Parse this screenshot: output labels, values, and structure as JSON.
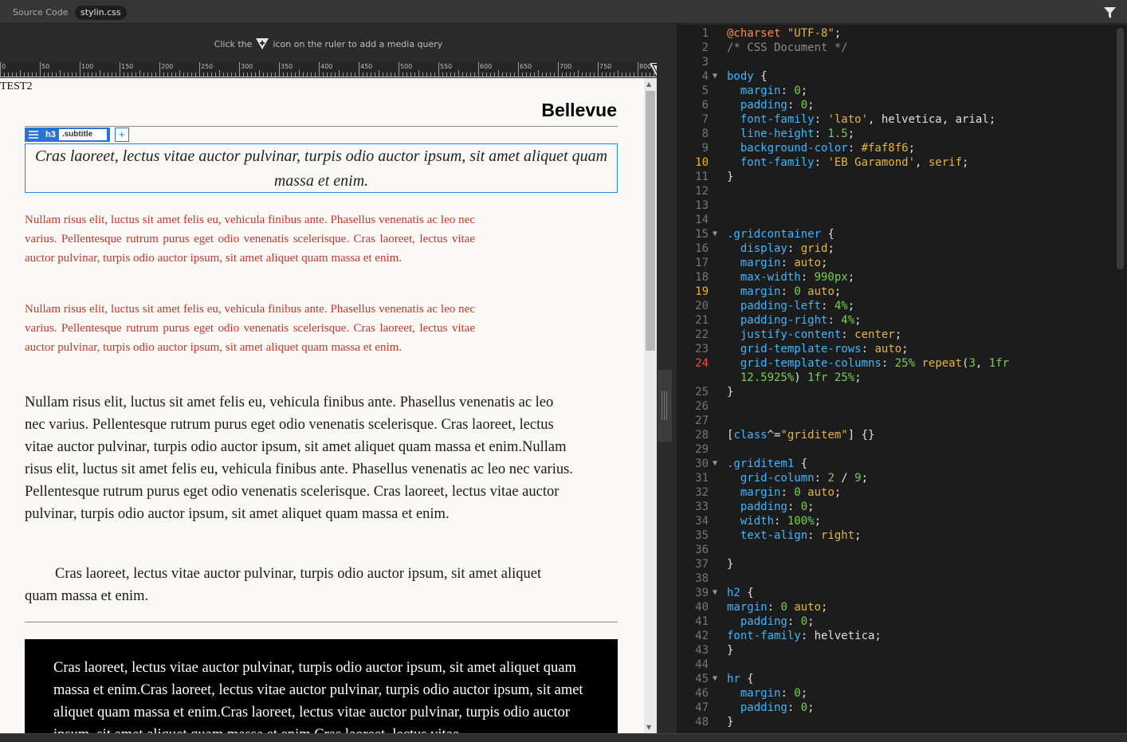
{
  "tabs": {
    "source_label": "Source Code",
    "file_label": "stylin.css"
  },
  "media_hint": {
    "before": "Click the",
    "after": "icon on the ruler to add a media query"
  },
  "ruler": {
    "labels": [
      "0",
      "50",
      "100",
      "150",
      "200",
      "250",
      "300",
      "350",
      "400",
      "450",
      "500",
      "550",
      "600",
      "650",
      "700",
      "750",
      "800"
    ]
  },
  "page": {
    "test_label": "TEST2",
    "heading": "Bellevue",
    "selector": {
      "tag": "h3",
      "class": ".subtitle",
      "add": "+"
    },
    "subtitle": "Cras laoreet, lectus vitae auctor pulvinar, turpis odio auctor ipsum, sit amet aliquet quam massa et enim.",
    "red_paragraphs": [
      "Nullam risus elit, luctus sit amet felis eu, vehicula finibus ante. Phasellus venenatis ac leo nec varius. Pellentesque rutrum purus eget odio venenatis scelerisque. Cras laoreet, lectus vitae auctor pulvinar, turpis odio auctor ipsum, sit amet aliquet quam massa et enim.",
      "Nullam risus elit, luctus sit amet felis eu, vehicula finibus ante. Phasellus venenatis ac leo nec varius. Pellentesque rutrum purus eget odio venenatis scelerisque. Cras laoreet, lectus vitae auctor pulvinar, turpis odio auctor ipsum, sit amet aliquet quam massa et enim."
    ],
    "body_paragraph": "Nullam risus elit, luctus sit amet felis eu, vehicula finibus ante. Phasellus venenatis ac leo nec varius. Pellentesque rutrum purus eget odio venenatis scelerisque. Cras laoreet, lectus vitae auctor pulvinar, turpis odio auctor ipsum, sit amet aliquet quam massa et enim.Nullam risus elit, luctus sit amet felis eu, vehicula finibus ante. Phasellus venenatis ac leo nec varius. Pellentesque rutrum purus eget odio venenatis scelerisque. Cras laoreet, lectus vitae auctor pulvinar, turpis odio auctor ipsum, sit amet aliquet quam massa et enim.",
    "indented_paragraph": "Cras laoreet, lectus vitae auctor pulvinar, turpis odio auctor ipsum, sit amet aliquet quam massa et enim.",
    "black_box": "Cras laoreet, lectus vitae auctor pulvinar, turpis odio auctor ipsum, sit amet aliquet quam massa et enim.Cras laoreet, lectus vitae auctor pulvinar, turpis odio auctor ipsum, sit amet aliquet quam massa et enim.Cras laoreet, lectus vitae auctor pulvinar, turpis odio auctor ipsum, sit amet aliquet quam massa et enim.Cras laoreet, lectus vitae"
  },
  "code": {
    "highlight_lines": [
      10,
      19
    ],
    "error_lines": [
      24
    ],
    "fold_lines": [
      4,
      15,
      30,
      39,
      45
    ],
    "lines": [
      {
        "n": "1",
        "t": [
          [
            "at",
            "@charset"
          ],
          [
            "w",
            " "
          ],
          [
            "s",
            "\"UTF-8\""
          ],
          [
            "w",
            ";"
          ]
        ]
      },
      {
        "n": "2",
        "t": [
          [
            "c",
            "/* CSS Document */"
          ]
        ]
      },
      {
        "n": "3",
        "t": []
      },
      {
        "n": "4",
        "t": [
          [
            "k",
            "body"
          ],
          [
            "w",
            " {"
          ]
        ]
      },
      {
        "n": "5",
        "t": [
          [
            "w",
            "  "
          ],
          [
            "p",
            "margin"
          ],
          [
            "w",
            ": "
          ],
          [
            "n",
            "0"
          ],
          [
            "w",
            ";"
          ]
        ]
      },
      {
        "n": "6",
        "t": [
          [
            "w",
            "  "
          ],
          [
            "p",
            "padding"
          ],
          [
            "w",
            ": "
          ],
          [
            "n",
            "0"
          ],
          [
            "w",
            ";"
          ]
        ]
      },
      {
        "n": "7",
        "t": [
          [
            "w",
            "  "
          ],
          [
            "p",
            "font-family"
          ],
          [
            "w",
            ": "
          ],
          [
            "s",
            "'lato'"
          ],
          [
            "w",
            ", helvetica, arial;"
          ]
        ]
      },
      {
        "n": "8",
        "t": [
          [
            "w",
            "  "
          ],
          [
            "p",
            "line-height"
          ],
          [
            "w",
            ": "
          ],
          [
            "n",
            "1.5"
          ],
          [
            "w",
            ";"
          ]
        ]
      },
      {
        "n": "9",
        "t": [
          [
            "w",
            "  "
          ],
          [
            "p",
            "background-color"
          ],
          [
            "w",
            ": "
          ],
          [
            "v",
            "#faf8f6"
          ],
          [
            "w",
            ";"
          ]
        ]
      },
      {
        "n": "10",
        "t": [
          [
            "w",
            "  "
          ],
          [
            "p",
            "font-family"
          ],
          [
            "w",
            ": "
          ],
          [
            "s",
            "'EB Garamond'"
          ],
          [
            "w",
            ", "
          ],
          [
            "v",
            "serif"
          ],
          [
            "w",
            ";"
          ]
        ]
      },
      {
        "n": "11",
        "t": [
          [
            "w",
            "}"
          ]
        ]
      },
      {
        "n": "12",
        "t": []
      },
      {
        "n": "13",
        "t": []
      },
      {
        "n": "14",
        "t": []
      },
      {
        "n": "15",
        "t": [
          [
            "k",
            ".gridcontainer"
          ],
          [
            "w",
            " {"
          ]
        ]
      },
      {
        "n": "16",
        "t": [
          [
            "w",
            "  "
          ],
          [
            "p",
            "display"
          ],
          [
            "w",
            ": "
          ],
          [
            "v",
            "grid"
          ],
          [
            "w",
            ";"
          ]
        ]
      },
      {
        "n": "17",
        "t": [
          [
            "w",
            "  "
          ],
          [
            "p",
            "margin"
          ],
          [
            "w",
            ": "
          ],
          [
            "v",
            "auto"
          ],
          [
            "w",
            ";"
          ]
        ]
      },
      {
        "n": "18",
        "t": [
          [
            "w",
            "  "
          ],
          [
            "p",
            "max-width"
          ],
          [
            "w",
            ": "
          ],
          [
            "n",
            "990px"
          ],
          [
            "w",
            ";"
          ]
        ]
      },
      {
        "n": "19",
        "t": [
          [
            "w",
            "  "
          ],
          [
            "p",
            "margin"
          ],
          [
            "w",
            ": "
          ],
          [
            "n",
            "0"
          ],
          [
            "w",
            " "
          ],
          [
            "v",
            "auto"
          ],
          [
            "w",
            ";"
          ]
        ]
      },
      {
        "n": "20",
        "t": [
          [
            "w",
            "  "
          ],
          [
            "p",
            "padding-left"
          ],
          [
            "w",
            ": "
          ],
          [
            "n",
            "4%"
          ],
          [
            "w",
            ";"
          ]
        ]
      },
      {
        "n": "21",
        "t": [
          [
            "w",
            "  "
          ],
          [
            "p",
            "padding-right"
          ],
          [
            "w",
            ": "
          ],
          [
            "n",
            "4%"
          ],
          [
            "w",
            ";"
          ]
        ]
      },
      {
        "n": "22",
        "t": [
          [
            "w",
            "  "
          ],
          [
            "p",
            "justify-content"
          ],
          [
            "w",
            ": "
          ],
          [
            "v",
            "center"
          ],
          [
            "w",
            ";"
          ]
        ]
      },
      {
        "n": "23",
        "t": [
          [
            "w",
            "  "
          ],
          [
            "p",
            "grid-template-rows"
          ],
          [
            "w",
            ": "
          ],
          [
            "v",
            "auto"
          ],
          [
            "w",
            ";"
          ]
        ]
      },
      {
        "n": "24",
        "t": [
          [
            "w",
            "  "
          ],
          [
            "p",
            "grid-template-columns"
          ],
          [
            "w",
            ": "
          ],
          [
            "n",
            "25%"
          ],
          [
            "w",
            " "
          ],
          [
            "v",
            "repeat"
          ],
          [
            "w",
            "("
          ],
          [
            "n",
            "3"
          ],
          [
            "w",
            ", "
          ],
          [
            "n",
            "1fr"
          ]
        ]
      },
      {
        "n": "",
        "t": [
          [
            "w",
            "  "
          ],
          [
            "n",
            "12.5925%"
          ],
          [
            "w",
            ") "
          ],
          [
            "n",
            "1fr"
          ],
          [
            "w",
            " "
          ],
          [
            "n",
            "25%"
          ],
          [
            "w",
            ";"
          ]
        ]
      },
      {
        "n": "25",
        "t": [
          [
            "w",
            "}"
          ]
        ]
      },
      {
        "n": "26",
        "t": []
      },
      {
        "n": "27",
        "t": []
      },
      {
        "n": "28",
        "t": [
          [
            "w",
            "["
          ],
          [
            "k",
            "class"
          ],
          [
            "w",
            "^="
          ],
          [
            "s",
            "\"griditem\""
          ],
          [
            "w",
            "] {}"
          ]
        ]
      },
      {
        "n": "29",
        "t": []
      },
      {
        "n": "30",
        "t": [
          [
            "k",
            ".griditem1"
          ],
          [
            "w",
            " {"
          ]
        ]
      },
      {
        "n": "31",
        "t": [
          [
            "w",
            "  "
          ],
          [
            "p",
            "grid-column"
          ],
          [
            "w",
            ": "
          ],
          [
            "n",
            "2"
          ],
          [
            "w",
            " / "
          ],
          [
            "n",
            "9"
          ],
          [
            "w",
            ";"
          ]
        ]
      },
      {
        "n": "32",
        "t": [
          [
            "w",
            "  "
          ],
          [
            "p",
            "margin"
          ],
          [
            "w",
            ": "
          ],
          [
            "n",
            "0"
          ],
          [
            "w",
            " "
          ],
          [
            "v",
            "auto"
          ],
          [
            "w",
            ";"
          ]
        ]
      },
      {
        "n": "33",
        "t": [
          [
            "w",
            "  "
          ],
          [
            "p",
            "padding"
          ],
          [
            "w",
            ": "
          ],
          [
            "n",
            "0"
          ],
          [
            "w",
            ";"
          ]
        ]
      },
      {
        "n": "34",
        "t": [
          [
            "w",
            "  "
          ],
          [
            "p",
            "width"
          ],
          [
            "w",
            ": "
          ],
          [
            "n",
            "100%"
          ],
          [
            "w",
            ";"
          ]
        ]
      },
      {
        "n": "35",
        "t": [
          [
            "w",
            "  "
          ],
          [
            "p",
            "text-align"
          ],
          [
            "w",
            ": "
          ],
          [
            "v",
            "right"
          ],
          [
            "w",
            ";"
          ]
        ]
      },
      {
        "n": "36",
        "t": []
      },
      {
        "n": "37",
        "t": [
          [
            "w",
            "}"
          ]
        ]
      },
      {
        "n": "38",
        "t": []
      },
      {
        "n": "39",
        "t": [
          [
            "k",
            "h2"
          ],
          [
            "w",
            " {"
          ]
        ]
      },
      {
        "n": "40",
        "t": [
          [
            "p",
            "margin"
          ],
          [
            "w",
            ": "
          ],
          [
            "n",
            "0"
          ],
          [
            "w",
            " "
          ],
          [
            "v",
            "auto"
          ],
          [
            "w",
            ";"
          ]
        ]
      },
      {
        "n": "41",
        "t": [
          [
            "w",
            "  "
          ],
          [
            "p",
            "padding"
          ],
          [
            "w",
            ": "
          ],
          [
            "n",
            "0"
          ],
          [
            "w",
            ";"
          ]
        ]
      },
      {
        "n": "42",
        "t": [
          [
            "p",
            "font-family"
          ],
          [
            "w",
            ": helvetica;"
          ]
        ]
      },
      {
        "n": "43",
        "t": [
          [
            "w",
            "}"
          ]
        ]
      },
      {
        "n": "44",
        "t": []
      },
      {
        "n": "45",
        "t": [
          [
            "k",
            "hr"
          ],
          [
            "w",
            " {"
          ]
        ]
      },
      {
        "n": "46",
        "t": [
          [
            "w",
            "  "
          ],
          [
            "p",
            "margin"
          ],
          [
            "w",
            ": "
          ],
          [
            "n",
            "0"
          ],
          [
            "w",
            ";"
          ]
        ]
      },
      {
        "n": "47",
        "t": [
          [
            "w",
            "  "
          ],
          [
            "p",
            "padding"
          ],
          [
            "w",
            ": "
          ],
          [
            "n",
            "0"
          ],
          [
            "w",
            ";"
          ]
        ]
      },
      {
        "n": "48",
        "t": [
          [
            "w",
            "}"
          ]
        ]
      }
    ]
  },
  "colors": {
    "accent": "#2475d4",
    "red_text": "#c0392b",
    "line_highlight": "#f6b21a",
    "line_error": "#ff4444"
  }
}
